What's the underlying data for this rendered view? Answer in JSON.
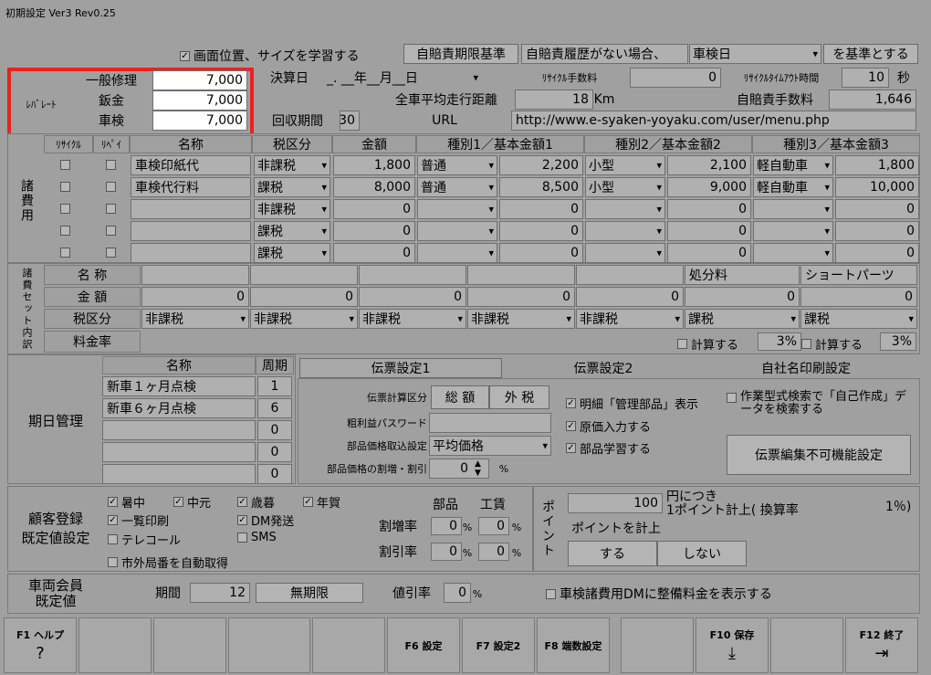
{
  "window_title": "初期設定 Ver3 Rev0.25",
  "top": {
    "learn_label": "画面位置、サイズを学習する",
    "jibai_label": "自賠責期限基準",
    "jibai_select": "自賠責履歴がない場合、",
    "shaken_select": "車検日",
    "kijun_label": "を基準とする"
  },
  "labor": {
    "title": "ﾚﾊﾞﾚｰﾄ",
    "rows": [
      {
        "label": "一般修理",
        "value": "7,000"
      },
      {
        "label": "鈑金",
        "value": "7,000"
      },
      {
        "label": "車検",
        "value": "7,000"
      }
    ]
  },
  "kessan": {
    "label": "決算日",
    "value": "_. __年__月__日",
    "kaishu_label": "回収期間",
    "kaishu_value": "30"
  },
  "recycle": {
    "fee_label": "ﾘｻｲｸﾙ手数料",
    "fee_value": "0",
    "timeout_label": "ﾘｻｲｸﾙﾀｲﾑｱｳﾄ時間",
    "timeout_value": "10",
    "timeout_unit": "秒"
  },
  "mileage": {
    "label": "全車平均走行距離",
    "value": "18",
    "unit": "Km"
  },
  "jibai_fee": {
    "label": "自賠責手数料",
    "value": "1,646"
  },
  "url": {
    "label": "URL",
    "value": "http://www.e-syaken-yoyaku.com/user/menu.php"
  },
  "fees": {
    "section": "諸費用",
    "headers": [
      "ﾘｻｲｸﾙ",
      "ﾘﾍﾟｲ",
      "名称",
      "税区分",
      "金額",
      "種別1／基本金額1",
      "種別2／基本金額2",
      "種別3／基本金額3"
    ],
    "rows": [
      {
        "name": "車検印紙代",
        "tax": "非課税",
        "amount": "1,800",
        "t1": "普通",
        "a1": "2,200",
        "t2": "小型",
        "a2": "2,100",
        "t3": "軽自動車",
        "a3": "1,800"
      },
      {
        "name": "車検代行料",
        "tax": "課税",
        "amount": "8,000",
        "t1": "普通",
        "a1": "8,500",
        "t2": "小型",
        "a2": "9,000",
        "t3": "軽自動車",
        "a3": "10,000"
      },
      {
        "name": "",
        "tax": "非課税",
        "amount": "0",
        "t1": "",
        "a1": "0",
        "t2": "",
        "a2": "0",
        "t3": "",
        "a3": "0"
      },
      {
        "name": "",
        "tax": "課税",
        "amount": "0",
        "t1": "",
        "a1": "0",
        "t2": "",
        "a2": "0",
        "t3": "",
        "a3": "0"
      },
      {
        "name": "",
        "tax": "課税",
        "amount": "0",
        "t1": "",
        "a1": "0",
        "t2": "",
        "a2": "0",
        "t3": "",
        "a3": "0"
      }
    ]
  },
  "set": {
    "section": "諸費セット内訳",
    "name_label": "名 称",
    "amount_label": "金 額",
    "tax_label": "税区分",
    "rate_label": "料金率",
    "names": [
      "",
      "",
      "",
      "",
      "",
      "処分料",
      "ショートパーツ"
    ],
    "amounts": [
      "0",
      "0",
      "0",
      "0",
      "0",
      "0",
      "0"
    ],
    "taxes": [
      "非課税",
      "非課税",
      "非課税",
      "非課税",
      "非課税",
      "課税",
      "課税"
    ],
    "calc1": "計算する",
    "rate1": "3",
    "calc2": "計算する",
    "rate2": "3"
  },
  "kijitsu": {
    "section": "期日管理",
    "name_header": "名称",
    "cycle_header": "周期",
    "rows": [
      {
        "name": "新車１ヶ月点検",
        "cycle": "1"
      },
      {
        "name": "新車６ヶ月点検",
        "cycle": "6"
      },
      {
        "name": "",
        "cycle": "0"
      },
      {
        "name": "",
        "cycle": "0"
      },
      {
        "name": "",
        "cycle": "0"
      }
    ]
  },
  "tabs": [
    "伝票設定1",
    "伝票設定2",
    "自社名印刷設定"
  ],
  "denpyo": {
    "calc_label": "伝票計算区分",
    "calc_opt1": "総 額",
    "calc_opt2": "外 税",
    "pass_label": "粗利益パスワード",
    "parts_label": "部品価格取込設定",
    "parts_value": "平均価格",
    "rate_label": "部品価格の割増・割引",
    "rate_value": "0",
    "rate_unit": "%",
    "chk1": "明細「管理部品」表示",
    "chk2": "原価入力する",
    "chk3": "部品学習する",
    "search_chk": "作業型式検索で「自己作成」データを検索する",
    "edit_btn": "伝票編集不可機能設定"
  },
  "kokyaku": {
    "section": "顧客登録\n既定値設定",
    "c1": "暑中",
    "c2": "中元",
    "c3": "歳暮",
    "c4": "年賀",
    "c5": "一覧印刷",
    "c6": "DM発送",
    "c7": "テレコール",
    "c8": "SMS",
    "c9": "市外局番を自動取得",
    "parts_label": "部品",
    "labor_label": "工賃",
    "up_label": "割増率",
    "down_label": "割引率",
    "up_parts": "0",
    "up_labor": "0",
    "down_parts": "0",
    "down_labor": "0",
    "pct": "%"
  },
  "point": {
    "section": "ポイント",
    "yen": "100",
    "line1": "円につき",
    "line2": "1ポイント計上(  換算率",
    "rate": "1％)",
    "add_label": "ポイントを計上",
    "yes": "する",
    "no": "しない"
  },
  "member": {
    "section": "車両会員\n既定値",
    "period_label": "期間",
    "period_value": "12",
    "unlimited": "無期限",
    "discount_label": "値引率",
    "discount_value": "0",
    "pct": "%",
    "dm_chk": "車検諸費用DMに整備料金を表示する"
  },
  "fkeys": [
    {
      "label": "F1 ヘルプ",
      "icon": "?"
    },
    {
      "label": "",
      "icon": ""
    },
    {
      "label": "",
      "icon": ""
    },
    {
      "label": "",
      "icon": ""
    },
    {
      "label": "",
      "icon": ""
    },
    {
      "label": "F6 設定",
      "icon": ""
    },
    {
      "label": "F7 設定2",
      "icon": ""
    },
    {
      "label": "F8 端数設定",
      "icon": ""
    },
    {
      "label": "",
      "icon": ""
    },
    {
      "label": "F10 保存",
      "icon": "⤓"
    },
    {
      "label": "",
      "icon": ""
    },
    {
      "label": "F12 終了",
      "icon": "⇥"
    }
  ],
  "highlight_color": "#e8231f"
}
